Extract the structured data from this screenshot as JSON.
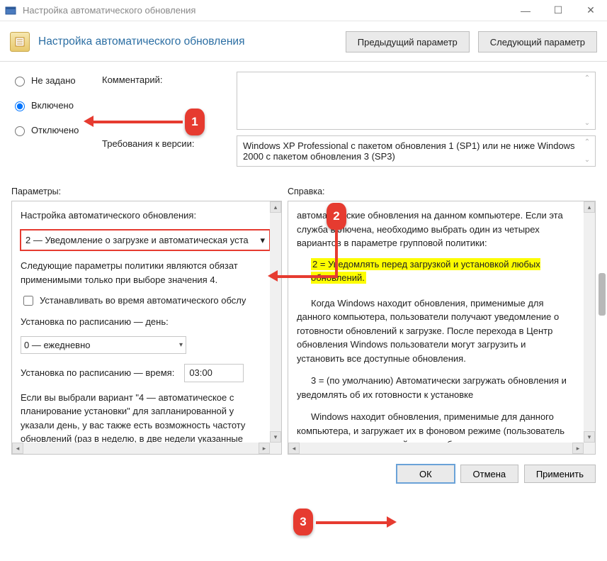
{
  "window": {
    "title": "Настройка автоматического обновления"
  },
  "header": {
    "title": "Настройка автоматического обновления",
    "prev": "Предыдущий параметр",
    "next": "Следующий параметр"
  },
  "radios": {
    "not_configured": "Не задано",
    "enabled": "Включено",
    "disabled": "Отключено"
  },
  "labels": {
    "comment": "Комментарий:",
    "requirements": "Требования к версии:",
    "parameters": "Параметры:",
    "help": "Справка:"
  },
  "comment_text": "",
  "requirements_text": "Windows XP Professional с пакетом обновления 1 (SP1) или не ниже Windows 2000 с пакетом обновления 3 (SP3)",
  "options": {
    "heading": "Настройка автоматического обновления:",
    "mode_selected": "2 — Уведомление о загрузке и автоматическая уста",
    "note": "Следующие параметры политики являются обязат применимыми только при выборе значения 4.",
    "install_during_maint": "Устанавливать во время автоматического обслу",
    "sched_day_label": "Установка по расписанию — день:",
    "sched_day_value": "0 — ежедневно",
    "sched_time_label": "Установка по расписанию — время:",
    "sched_time_value": "03:00",
    "footnote": "Если вы выбрали вариант \"4 — автоматическое с планирование установки\" для запланированной у указали день, у вас также есть возможность частоту обновлений (раз в неделю, в две недели указанные варианты, описанные ниже"
  },
  "help": {
    "p1": "автоматические обновления на данном компьютере. Если эта служба включена, необходимо выбрать один из четырех вариантов в параметре групповой политики:",
    "hl": "2 = Уведомлять перед загрузкой и установкой любых обновлений.",
    "p2": "Когда Windows находит обновления, применимые для данного компьютера, пользователи получают уведомление о готовности обновлений к загрузке. После перехода в Центр обновления Windows пользователи могут загрузить и установить все доступные обновления.",
    "p3": "3 = (по умолчанию) Автоматически загружать обновления и уведомлять об их готовности к установке",
    "p4": "Windows находит обновления, применимые для данного компьютера, и загружает их в фоновом режиме (пользователь не получает уведомлений, и его работа при этом не"
  },
  "footer": {
    "ok": "ОК",
    "cancel": "Отмена",
    "apply": "Применить"
  },
  "badges": {
    "b1": "1",
    "b2": "2",
    "b3": "3"
  }
}
